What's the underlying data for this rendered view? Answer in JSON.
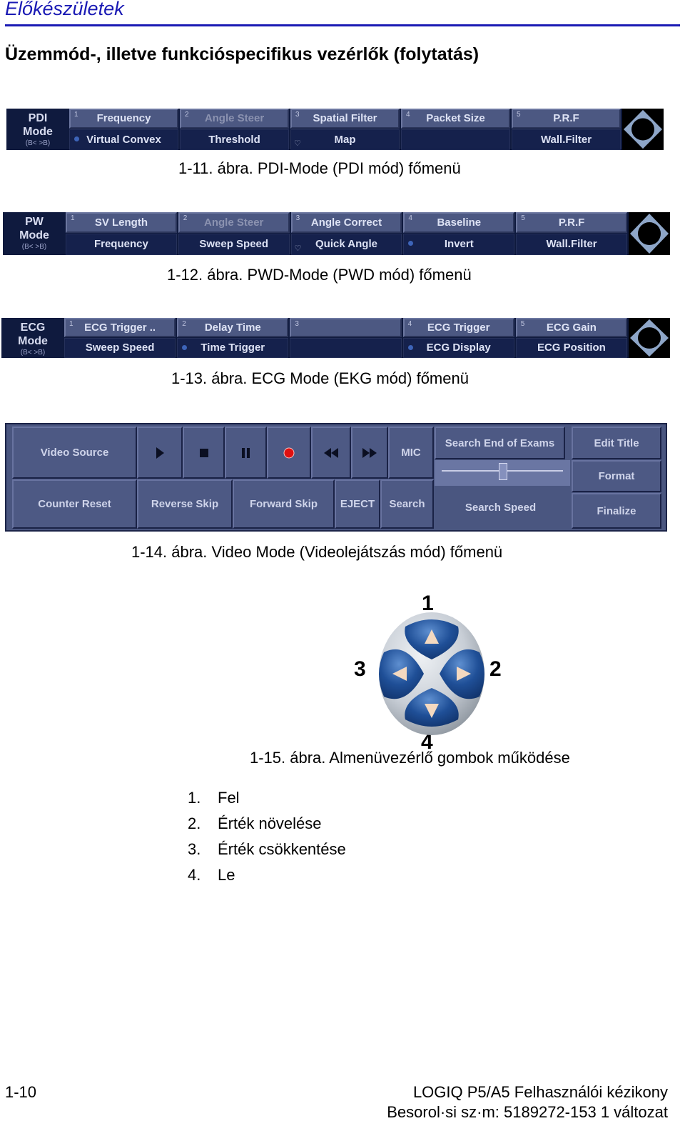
{
  "header": {
    "section": "Előkészületek",
    "title": "Üzemmód-, illetve funkcióspecifikus vezérlők (folytatás)"
  },
  "menus": [
    {
      "id": "pdi",
      "mode_line1": "PDI",
      "mode_line2": "Mode",
      "mode_sub": "(B< >B)",
      "top": [
        {
          "num": "1",
          "label": "Frequency",
          "dim": false
        },
        {
          "num": "2",
          "label": "Angle Steer",
          "dim": true
        },
        {
          "num": "3",
          "label": "Spatial Filter",
          "dim": false
        },
        {
          "num": "4",
          "label": "Packet Size",
          "dim": false
        },
        {
          "num": "5",
          "label": "P.R.F",
          "dim": false
        }
      ],
      "bottom": [
        {
          "marker": "dot",
          "label": "Virtual Convex"
        },
        {
          "marker": "",
          "label": "Threshold"
        },
        {
          "marker": "hand",
          "label": "Map"
        },
        {
          "marker": "",
          "label": ""
        },
        {
          "marker": "",
          "label": "Wall.Filter"
        }
      ],
      "caption": "1-11.  ábra.  PDI-Mode (PDI mód) főmenü"
    },
    {
      "id": "pw",
      "mode_line1": "PW",
      "mode_line2": "Mode",
      "mode_sub": "(B< >B)",
      "top": [
        {
          "num": "1",
          "label": "SV Length",
          "dim": false
        },
        {
          "num": "2",
          "label": "Angle Steer",
          "dim": true
        },
        {
          "num": "3",
          "label": "Angle Correct",
          "dim": false
        },
        {
          "num": "4",
          "label": "Baseline",
          "dim": false
        },
        {
          "num": "5",
          "label": "P.R.F",
          "dim": false
        }
      ],
      "bottom": [
        {
          "marker": "",
          "label": "Frequency"
        },
        {
          "marker": "",
          "label": "Sweep Speed"
        },
        {
          "marker": "hand",
          "label": "Quick Angle"
        },
        {
          "marker": "dot",
          "label": "Invert"
        },
        {
          "marker": "",
          "label": "Wall.Filter"
        }
      ],
      "caption": "1-12.  ábra.  PWD-Mode (PWD mód) főmenü"
    },
    {
      "id": "ecg",
      "mode_line1": "ECG",
      "mode_line2": "Mode",
      "mode_sub": "(B< >B)",
      "top": [
        {
          "num": "1",
          "label": "ECG Trigger ..",
          "dim": false
        },
        {
          "num": "2",
          "label": "Delay Time",
          "dim": false
        },
        {
          "num": "3",
          "label": "",
          "dim": false
        },
        {
          "num": "4",
          "label": "ECG Trigger",
          "dim": false
        },
        {
          "num": "5",
          "label": "ECG Gain",
          "dim": false
        }
      ],
      "bottom": [
        {
          "marker": "",
          "label": "Sweep Speed"
        },
        {
          "marker": "dot",
          "label": "Time Trigger"
        },
        {
          "marker": "",
          "label": ""
        },
        {
          "marker": "dot",
          "label": "ECG Display"
        },
        {
          "marker": "",
          "label": "ECG Position"
        }
      ],
      "caption": "1-13.  ábra.  ECG Mode (EKG mód) főmenü"
    }
  ],
  "video": {
    "video_source": "Video Source",
    "play_icon": "play-icon",
    "stop_icon": "stop-icon",
    "pause_icon": "pause-icon",
    "record_icon": "record-icon",
    "rewind_icon": "rewind-icon",
    "fast_forward_icon": "fast-forward-icon",
    "mic": "MIC",
    "search_end": "Search End of Exams",
    "edit_title": "Edit Title",
    "format": "Format",
    "finalize": "Finalize",
    "counter_reset": "Counter Reset",
    "reverse_skip": "Reverse Skip",
    "forward_skip": "Forward Skip",
    "eject": "EJECT",
    "search": "Search",
    "search_speed": "Search Speed",
    "search_speed_value": 0.5,
    "record_color": "#e01010",
    "caption": "1-14.  ábra.  Video Mode (Videolejátszás mód) főmenü"
  },
  "pad": {
    "label_up": "1",
    "label_right": "2",
    "label_left": "3",
    "label_down": "4",
    "caption": "1-15.  ábra.  Almenüvezérlő gombok működése",
    "items": [
      {
        "n": "1.",
        "text": "Fel"
      },
      {
        "n": "2.",
        "text": "Érték növelése"
      },
      {
        "n": "3.",
        "text": "Érték csökkentése"
      },
      {
        "n": "4.",
        "text": "Le"
      }
    ]
  },
  "footer": {
    "page": "1-10",
    "manual": "LOGIQ P5/A5 Felhasználói kézikony",
    "part": "Besorol·si sz·m: 5189272-153 1 változat"
  }
}
